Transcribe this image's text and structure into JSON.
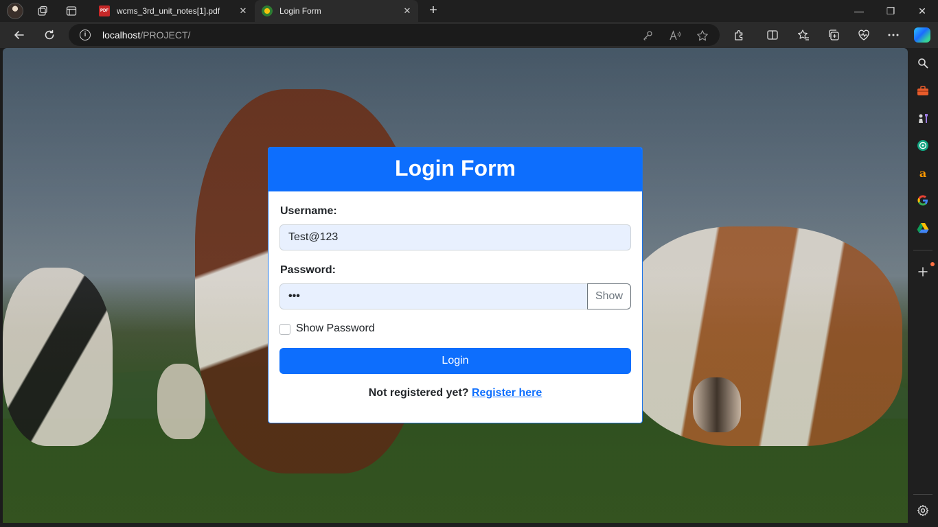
{
  "browser": {
    "tabs": [
      {
        "title": "wcms_3rd_unit_notes[1].pdf",
        "favicon": "pdf-icon",
        "favicon_text": "PDF",
        "active": false
      },
      {
        "title": "Login Form",
        "favicon": "site-favicon",
        "active": true
      }
    ],
    "close_glyph": "✕",
    "new_tab_glyph": "+",
    "window_controls": {
      "minimize": "—",
      "restore": "❐",
      "close": "✕"
    },
    "address": {
      "host": "localhost",
      "path": "/PROJECT/"
    },
    "info_glyph": "i"
  },
  "page": {
    "form": {
      "title": "Login Form",
      "username_label": "Username:",
      "username_value": "Test@123",
      "password_label": "Password:",
      "password_value": "•••",
      "show_button": "Show",
      "show_password_label": "Show Password",
      "login_button": "Login",
      "register_prompt": "Not registered yet?",
      "register_link": "Register here"
    }
  },
  "colors": {
    "primary": "#0d6efd",
    "input_bg": "#e8f0fe",
    "chrome_dark": "#1f1f1f",
    "toolbar": "#2b2b2b"
  },
  "sidebar": {
    "icons": [
      "search-icon",
      "toolbox-icon",
      "chess-icon",
      "chatgpt-icon",
      "amazon-icon",
      "google-icon",
      "drive-icon",
      "add-icon",
      "settings-icon"
    ]
  }
}
